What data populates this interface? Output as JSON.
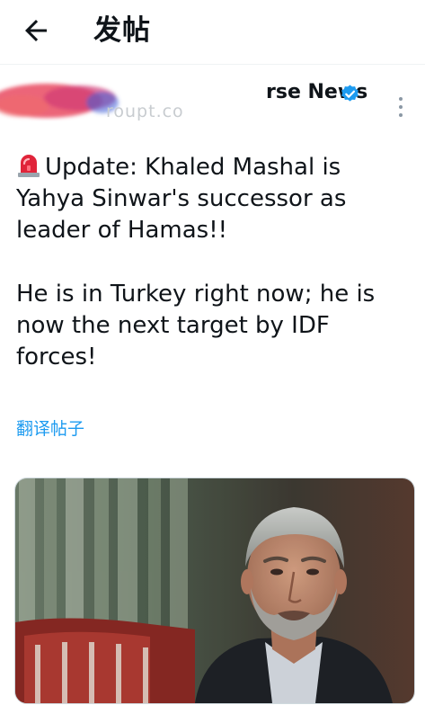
{
  "header": {
    "title": "发帖"
  },
  "post": {
    "author_name_partial": "rse News",
    "handle_partial": "roupt.co",
    "text_line1": "Update: Khaled Mashal is Yahya Sinwar's successor as leader of Hamas!!",
    "text_line2": "He is in Turkey right now; he is now the next target by IDF forces!",
    "translate_label": "翻译帖子"
  },
  "icons": {
    "back": "arrow-left-icon",
    "verified": "verified-badge-icon",
    "more": "more-vertical-icon",
    "siren": "police-light-emoji"
  },
  "colors": {
    "accent": "#1d9bf0",
    "text": "#0f1419",
    "scribble": "#e8304a"
  }
}
